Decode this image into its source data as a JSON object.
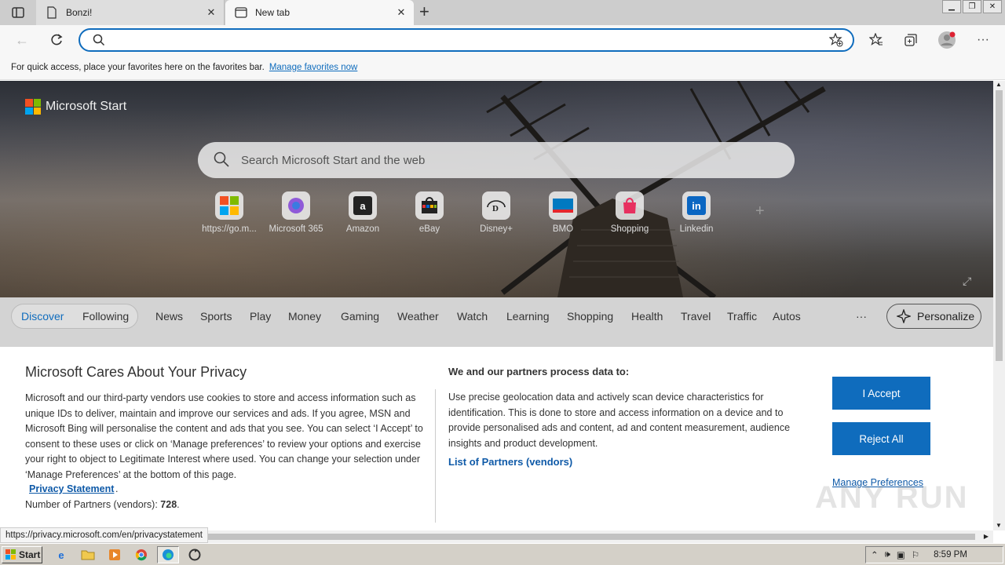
{
  "tabs": [
    {
      "title": "Bonzi!",
      "close": "✕"
    },
    {
      "title": "New tab",
      "close": "✕"
    }
  ],
  "new_tab_label": "+",
  "address": {
    "value": "",
    "placeholder": ""
  },
  "favbar": {
    "text": "For quick access, place your favorites here on the favorites bar.",
    "link": "Manage favorites now"
  },
  "hero": {
    "brand": "Microsoft Start",
    "search_placeholder": "Search Microsoft Start and the web",
    "quicklinks": [
      {
        "label": "https://go.m...",
        "glyph": "▦"
      },
      {
        "label": "Microsoft 365",
        "glyph": "◉"
      },
      {
        "label": "Amazon",
        "glyph": "a"
      },
      {
        "label": "eBay",
        "glyph": "▤"
      },
      {
        "label": "Disney+",
        "glyph": "D"
      },
      {
        "label": "BMO",
        "glyph": "▭"
      },
      {
        "label": "Shopping",
        "glyph": "♞"
      },
      {
        "label": "Linkedin",
        "glyph": "in"
      }
    ],
    "add_glyph": "+",
    "expand_glyph": "⤢"
  },
  "categories": {
    "active": [
      "Discover",
      "Following"
    ],
    "items": [
      "News",
      "Sports",
      "Play",
      "Money",
      "Gaming",
      "Weather",
      "Watch",
      "Learning",
      "Shopping",
      "Health",
      "Travel",
      "Traffic",
      "Autos"
    ],
    "more": "···",
    "personalize": "Personalize"
  },
  "privacy": {
    "title": "Microsoft Cares About Your Privacy",
    "body": "Microsoft and our third-party vendors use cookies to store and access information such as unique IDs to deliver, maintain and improve our services and ads. If you agree, MSN and Microsoft Bing will personalise the content and ads that you see. You can select ‘I Accept’ to consent to these uses or click on ‘Manage preferences’ to review your options and exercise your right to object to Legitimate Interest where used.  You can change your selection under ‘Manage Preferences’ at the bottom of this page.",
    "statement_link": "Privacy Statement",
    "statement_dot": ".",
    "partners_label": "Number of Partners (vendors): ",
    "partners_count": "728",
    "partners_end": ".",
    "subtitle": "We and our partners process data to:",
    "body2": "Use precise geolocation data and actively scan device characteristics for identification. This is done to store and access information on a device and to provide personalised ads and content, ad and content measurement, audience insights and product development.",
    "vendors_link": "List of Partners (vendors)",
    "accept": "I Accept",
    "reject": "Reject All",
    "manage": "Manage Preferences"
  },
  "status_url": "https://privacy.microsoft.com/en/privacystatement",
  "watermark": "ANY RUN",
  "taskbar": {
    "start": "Start",
    "time": "8:59 PM"
  },
  "colors": {
    "accent": "#0f6cbd",
    "link": "#0f5aa8"
  }
}
